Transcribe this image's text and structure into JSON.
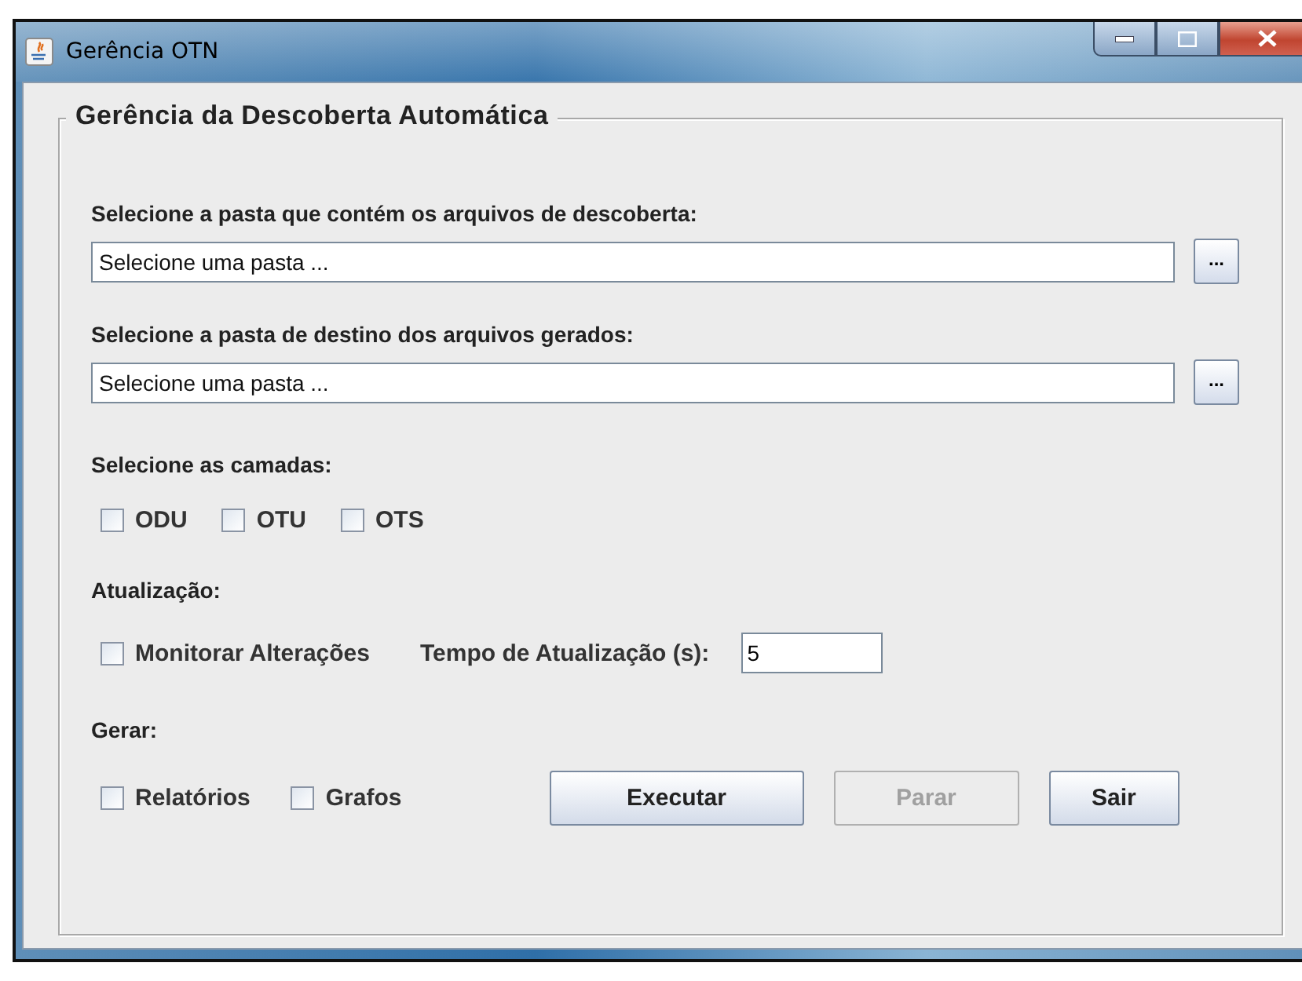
{
  "window": {
    "title": "Gerência OTN"
  },
  "group": {
    "title": "Gerência da Descoberta Automática"
  },
  "folders": [
    {
      "label": "Selecione a pasta que contém os arquivos de descoberta:",
      "value": "Selecione uma pasta ...",
      "browse": "..."
    },
    {
      "label": "Selecione a pasta de destino dos arquivos gerados:",
      "value": "Selecione uma pasta ...",
      "browse": "..."
    }
  ],
  "layers": {
    "label": "Selecione as camadas:",
    "options": [
      {
        "label": "ODU",
        "checked": false
      },
      {
        "label": "OTU",
        "checked": false
      },
      {
        "label": "OTS",
        "checked": false
      }
    ]
  },
  "update": {
    "label": "Atualização:",
    "monitor": {
      "label": "Monitorar Alterações",
      "checked": false
    },
    "interval_label": "Tempo de Atualização (s):",
    "interval_value": "5"
  },
  "generate": {
    "label": "Gerar:",
    "options": [
      {
        "label": "Relatórios",
        "checked": false
      },
      {
        "label": "Grafos",
        "checked": false
      }
    ]
  },
  "buttons": [
    {
      "label": "Executar",
      "disabled": false
    },
    {
      "label": "Parar",
      "disabled": true
    },
    {
      "label": "Sair",
      "disabled": false
    }
  ]
}
